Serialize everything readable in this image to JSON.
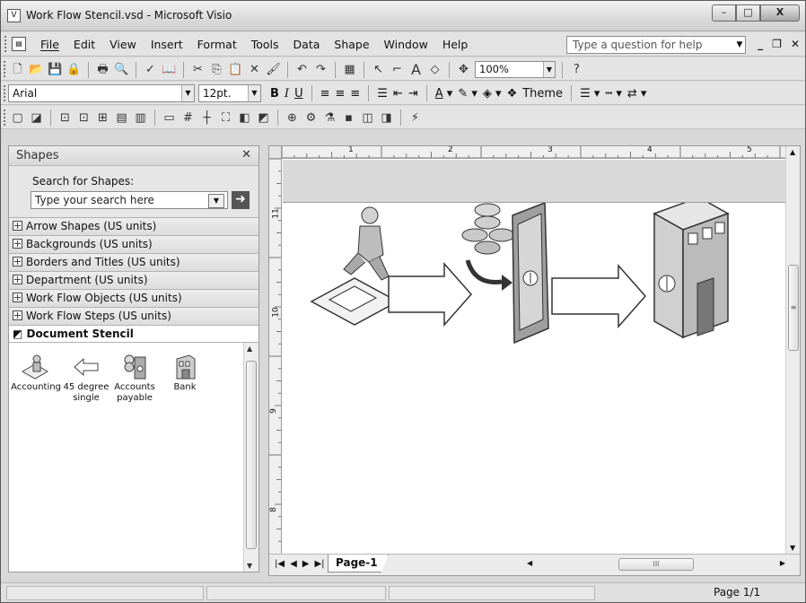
{
  "window": {
    "title": "Work Flow Stencil.vsd - Microsoft Visio",
    "buttons": [
      "–",
      "□",
      "X"
    ]
  },
  "menu": {
    "items": [
      "File",
      "Edit",
      "View",
      "Insert",
      "Format",
      "Tools",
      "Data",
      "Shape",
      "Window",
      "Help"
    ],
    "help_placeholder": "Type a question for help"
  },
  "toolbar_format": {
    "font": "Arial",
    "size": "12pt.",
    "theme_label": "Theme"
  },
  "toolbar_standard": {
    "zoom": "100%"
  },
  "shapes_pane": {
    "title": "Shapes",
    "search_label": "Search for Shapes:",
    "search_placeholder": "Type your search here",
    "stencils": [
      "Arrow Shapes (US units)",
      "Backgrounds (US units)",
      "Borders and Titles (US units)",
      "Department (US units)",
      "Work Flow Objects (US units)",
      "Work Flow Steps (US units)"
    ],
    "active_stencil": "Document Stencil",
    "masters": [
      {
        "label": "Accounting",
        "icon": "accounting-icon"
      },
      {
        "label": "45 degree single",
        "icon": "arrow-left-icon"
      },
      {
        "label": "Accounts payable",
        "icon": "accounts-payable-icon"
      },
      {
        "label": "Bank",
        "icon": "bank-icon"
      }
    ]
  },
  "ruler": {
    "top": [
      "1",
      "2",
      "3",
      "4",
      "5"
    ],
    "left": [
      "11",
      "10",
      "9",
      "8"
    ]
  },
  "drawing": {
    "page_tab": "Page-1"
  },
  "status": {
    "page": "Page 1/1"
  },
  "colors": {
    "chrome": "#d8d8d8",
    "canvas": "#ffffff",
    "stencil_active_bg": "#ffffff"
  }
}
